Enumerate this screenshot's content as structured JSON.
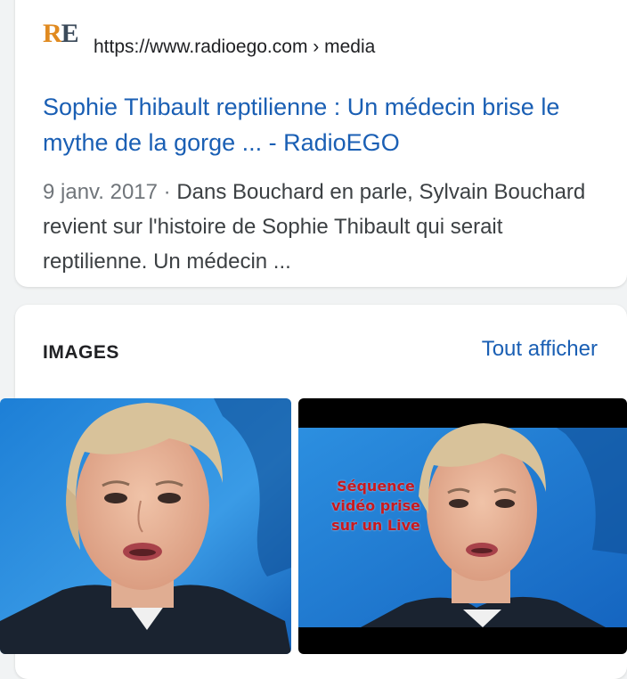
{
  "result": {
    "favicon_letters": [
      "R",
      "E"
    ],
    "url": "https://www.radioego.com › media",
    "title": "Sophie Thibault reptilienne : Un médecin brise le mythe de la gorge ... - RadioEGO",
    "date": "9 janv. 2017",
    "separator": " · ",
    "snippet": "Dans Bouchard en parle, Sylvain Bouchard revient sur l'histoire de Sophie Thibault qui serait reptilienne. Un médecin ..."
  },
  "images_section": {
    "heading": "IMAGES",
    "see_all": "Tout afficher",
    "thumbnails": [
      {
        "overlay_text": ""
      },
      {
        "overlay_text": "Séquence vidéo prise sur un Live"
      }
    ]
  },
  "colors": {
    "link": "#1a5fb4",
    "background": "#f1f3f4",
    "overlay_text": "#c9191e"
  }
}
